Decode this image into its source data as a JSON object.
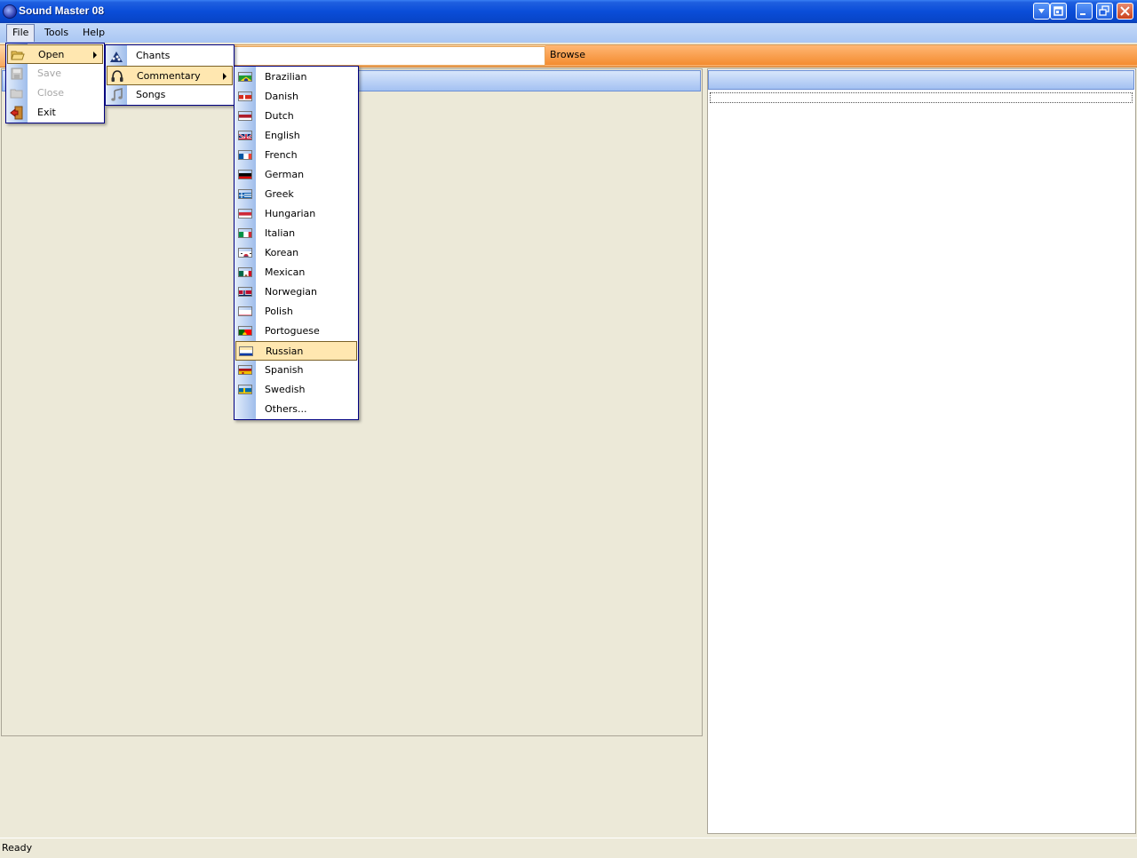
{
  "window": {
    "title": "Sound Master 08"
  },
  "menubar": {
    "items": [
      "File",
      "Tools",
      "Help"
    ]
  },
  "toolbar": {
    "path_value": "",
    "browse_label": "Browse"
  },
  "file_menu": {
    "items": [
      {
        "label": "Open",
        "icon": "folder-open-icon",
        "disabled": false,
        "submenu": true
      },
      {
        "label": "Save",
        "icon": "save-icon",
        "disabled": true
      },
      {
        "label": "Close",
        "icon": "close-folder-icon",
        "disabled": true
      },
      {
        "label": "Exit",
        "icon": "exit-icon",
        "disabled": false
      }
    ]
  },
  "open_menu": {
    "items": [
      {
        "label": "Chants",
        "icon": "crowd-icon"
      },
      {
        "label": "Commentary",
        "icon": "headphones-icon",
        "submenu": true
      },
      {
        "label": "Songs",
        "icon": "music-note-icon"
      }
    ]
  },
  "commentary_menu": {
    "items": [
      {
        "label": "Brazilian",
        "flag": "brazil"
      },
      {
        "label": "Danish",
        "flag": "denmark"
      },
      {
        "label": "Dutch",
        "flag": "netherlands"
      },
      {
        "label": "English",
        "flag": "uk"
      },
      {
        "label": "French",
        "flag": "france"
      },
      {
        "label": "German",
        "flag": "germany"
      },
      {
        "label": "Greek",
        "flag": "greece"
      },
      {
        "label": "Hungarian",
        "flag": "hungary"
      },
      {
        "label": "Italian",
        "flag": "italy"
      },
      {
        "label": "Korean",
        "flag": "korea"
      },
      {
        "label": "Mexican",
        "flag": "mexico"
      },
      {
        "label": "Norwegian",
        "flag": "norway"
      },
      {
        "label": "Polish",
        "flag": "poland"
      },
      {
        "label": "Portoguese",
        "flag": "portugal"
      },
      {
        "label": "Russian",
        "flag": "russia"
      },
      {
        "label": "Spanish",
        "flag": "spain"
      },
      {
        "label": "Swedish",
        "flag": "sweden"
      },
      {
        "label": "Others...",
        "flag": ""
      }
    ],
    "highlighted": "Russian"
  },
  "statusbar": {
    "text": "Ready"
  },
  "colors": {
    "menu_highlight": "#FFE7B0",
    "titlebar": "#0A4DD8",
    "toolbar_orange": "#F7A75E"
  }
}
